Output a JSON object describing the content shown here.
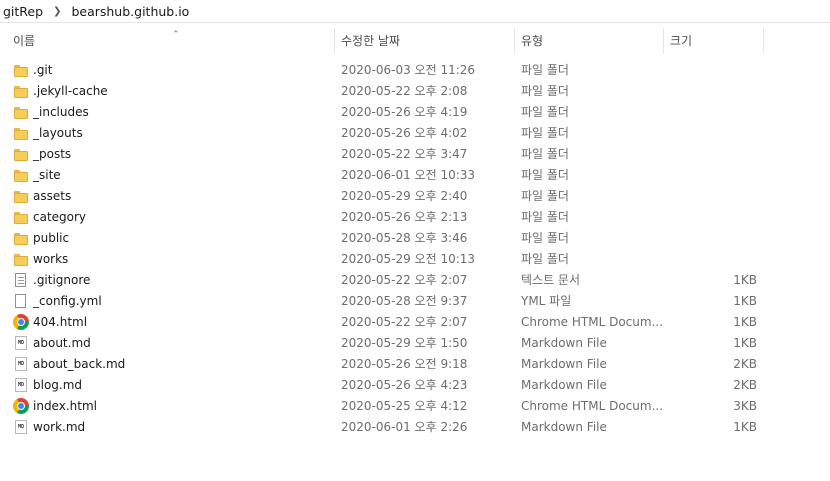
{
  "breadcrumb": {
    "items": [
      "gitRep",
      "bearshub.github.io"
    ]
  },
  "columns": {
    "name": "이름",
    "date": "수정한 날짜",
    "type": "유형",
    "size": "크기"
  },
  "files": [
    {
      "name": ".git",
      "date": "2020-06-03 오전 11:26",
      "type": "파일 폴더",
      "size": "",
      "icon": "folder-icon"
    },
    {
      "name": ".jekyll-cache",
      "date": "2020-05-22 오후 2:08",
      "type": "파일 폴더",
      "size": "",
      "icon": "folder-icon"
    },
    {
      "name": "_includes",
      "date": "2020-05-26 오후 4:19",
      "type": "파일 폴더",
      "size": "",
      "icon": "folder-icon"
    },
    {
      "name": "_layouts",
      "date": "2020-05-26 오후 4:02",
      "type": "파일 폴더",
      "size": "",
      "icon": "folder-icon"
    },
    {
      "name": "_posts",
      "date": "2020-05-22 오후 3:47",
      "type": "파일 폴더",
      "size": "",
      "icon": "folder-icon"
    },
    {
      "name": "_site",
      "date": "2020-06-01 오전 10:33",
      "type": "파일 폴더",
      "size": "",
      "icon": "folder-icon"
    },
    {
      "name": "assets",
      "date": "2020-05-29 오후 2:40",
      "type": "파일 폴더",
      "size": "",
      "icon": "folder-icon"
    },
    {
      "name": "category",
      "date": "2020-05-26 오후 2:13",
      "type": "파일 폴더",
      "size": "",
      "icon": "folder-icon"
    },
    {
      "name": "public",
      "date": "2020-05-28 오후 3:46",
      "type": "파일 폴더",
      "size": "",
      "icon": "folder-icon"
    },
    {
      "name": "works",
      "date": "2020-05-29 오전 10:13",
      "type": "파일 폴더",
      "size": "",
      "icon": "folder-icon"
    },
    {
      "name": ".gitignore",
      "date": "2020-05-22 오후 2:07",
      "type": "텍스트 문서",
      "size": "1KB",
      "icon": "text-file-icon"
    },
    {
      "name": "_config.yml",
      "date": "2020-05-28 오전 9:37",
      "type": "YML 파일",
      "size": "1KB",
      "icon": "file-icon"
    },
    {
      "name": "404.html",
      "date": "2020-05-22 오후 2:07",
      "type": "Chrome HTML Docum...",
      "size": "1KB",
      "icon": "chrome-icon"
    },
    {
      "name": "about.md",
      "date": "2020-05-29 오후 1:50",
      "type": "Markdown File",
      "size": "1KB",
      "icon": "markdown-file-icon"
    },
    {
      "name": "about_back.md",
      "date": "2020-05-26 오전 9:18",
      "type": "Markdown File",
      "size": "2KB",
      "icon": "markdown-file-icon"
    },
    {
      "name": "blog.md",
      "date": "2020-05-26 오후 4:23",
      "type": "Markdown File",
      "size": "2KB",
      "icon": "markdown-file-icon"
    },
    {
      "name": "index.html",
      "date": "2020-05-25 오후 4:12",
      "type": "Chrome HTML Docum...",
      "size": "3KB",
      "icon": "chrome-icon"
    },
    {
      "name": "work.md",
      "date": "2020-06-01 오후 2:26",
      "type": "Markdown File",
      "size": "1KB",
      "icon": "markdown-file-icon"
    }
  ]
}
